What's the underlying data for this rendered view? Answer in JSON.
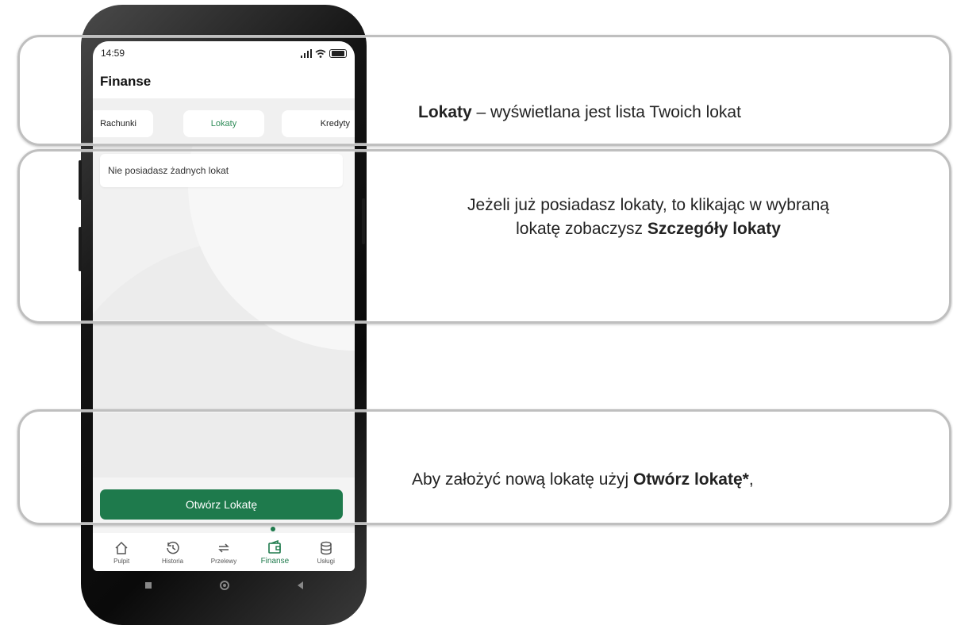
{
  "status_bar": {
    "time": "14:59"
  },
  "header": {
    "title": "Finanse"
  },
  "tabs": [
    {
      "label": "Rachunki",
      "active": false
    },
    {
      "label": "Lokaty",
      "active": true
    },
    {
      "label": "Kredyty",
      "active": false
    }
  ],
  "content": {
    "empty_message": "Nie posiadasz żadnych lokat"
  },
  "primary_button": {
    "label": "Otwórz Lokatę"
  },
  "bottom_nav": [
    {
      "label": "Pulpit",
      "icon": "home-icon",
      "active": false
    },
    {
      "label": "Historia",
      "icon": "history-icon",
      "active": false
    },
    {
      "label": "Przelewy",
      "icon": "transfer-icon",
      "active": false
    },
    {
      "label": "Finanse",
      "icon": "finance-icon",
      "active": true
    },
    {
      "label": "Usługi",
      "icon": "database-icon",
      "active": false
    }
  ],
  "callouts": {
    "c1": {
      "bold": "Lokaty",
      "text": " – wyświetlana jest lista Twoich lokat"
    },
    "c2": {
      "line1": "Jeżeli już posiadasz lokaty, to klikając w wybraną",
      "line2_prefix": "lokatę zobaczysz ",
      "line2_bold": "Szczegóły lokaty"
    },
    "c3": {
      "prefix": "Aby założyć nową lokatę użyj ",
      "bold": "Otwórz lokatę*",
      "suffix": ","
    }
  },
  "colors": {
    "accent": "#1e7a4c",
    "active_tab_text": "#2e8b57",
    "frame": "#bfbfbf"
  }
}
